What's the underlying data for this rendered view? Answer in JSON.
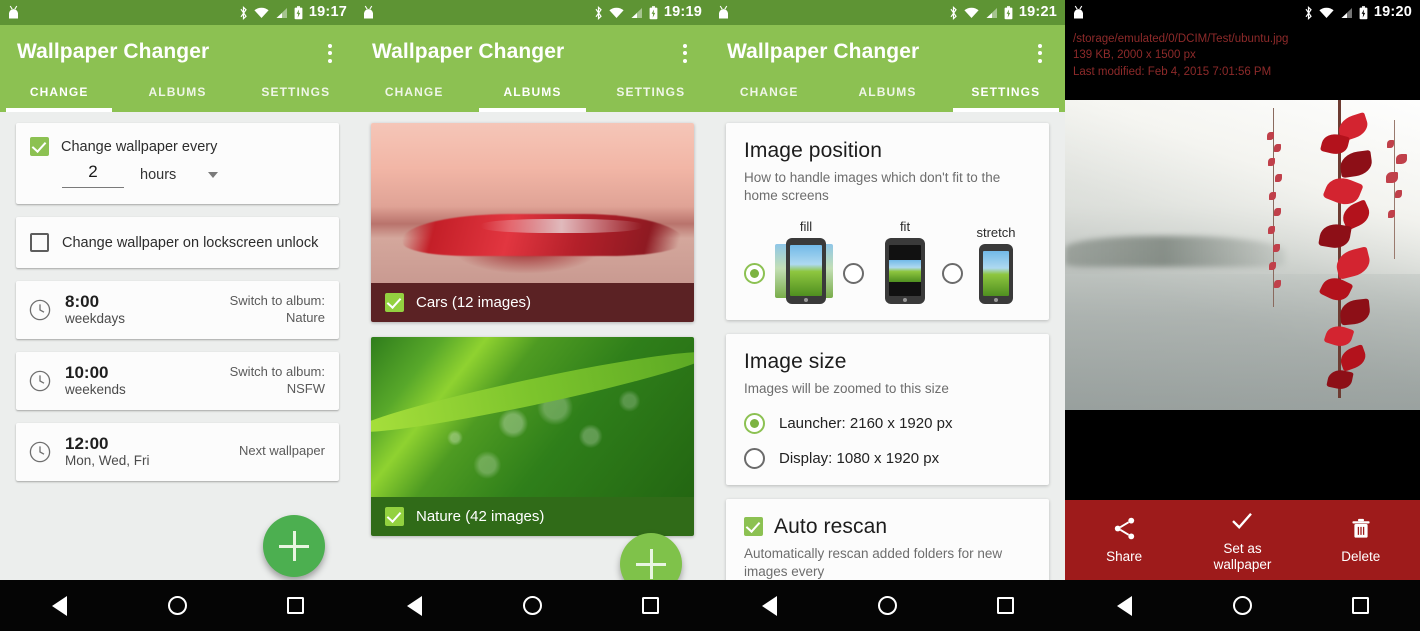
{
  "app": {
    "title": "Wallpaper Changer"
  },
  "panels": [
    {
      "status": {
        "time": "19:17"
      },
      "tabs": [
        {
          "label": "CHANGE",
          "active": true
        },
        {
          "label": "ALBUMS",
          "active": false
        },
        {
          "label": "SETTINGS",
          "active": false
        }
      ],
      "interval_card": {
        "label": "Change wallpaper every",
        "checked": true,
        "value": "2",
        "unit": "hours"
      },
      "lockscreen_card": {
        "label": "Change wallpaper on lockscreen unlock",
        "checked": false
      },
      "schedules": [
        {
          "time": "8:00",
          "days": "weekdays",
          "action_line1": "Switch to album:",
          "action_line2": "Nature"
        },
        {
          "time": "10:00",
          "days": "weekends",
          "action_line1": "Switch to album:",
          "action_line2": "NSFW"
        },
        {
          "time": "12:00",
          "days": "Mon, Wed, Fri",
          "action_line1": "Next wallpaper",
          "action_line2": ""
        }
      ],
      "fab": {
        "icon": "plus-icon"
      }
    },
    {
      "status": {
        "time": "19:19"
      },
      "tabs": [
        {
          "label": "CHANGE",
          "active": false
        },
        {
          "label": "ALBUMS",
          "active": true
        },
        {
          "label": "SETTINGS",
          "active": false
        }
      ],
      "albums": [
        {
          "name": "Cars (12 images)",
          "checked": true,
          "thumb": "red-sports-car-at-sunset"
        },
        {
          "name": "Nature (42 images)",
          "checked": true,
          "thumb": "green-leaf-with-water-drops"
        }
      ],
      "fab": {
        "icon": "plus-icon"
      }
    },
    {
      "status": {
        "time": "19:21"
      },
      "tabs": [
        {
          "label": "CHANGE",
          "active": false
        },
        {
          "label": "ALBUMS",
          "active": false
        },
        {
          "label": "SETTINGS",
          "active": true
        }
      ],
      "image_position": {
        "title": "Image position",
        "subtitle": "How to handle images which don't fit to the home screens",
        "options": [
          {
            "label": "fill",
            "selected": true
          },
          {
            "label": "fit",
            "selected": false
          },
          {
            "label": "stretch",
            "selected": false
          }
        ]
      },
      "image_size": {
        "title": "Image size",
        "subtitle": "Images will be zoomed to this size",
        "options": [
          {
            "label": "Launcher: 2160 x 1920 px",
            "selected": true
          },
          {
            "label": "Display: 1080 x 1920 px",
            "selected": false
          }
        ]
      },
      "auto_rescan": {
        "title": "Auto rescan",
        "checked": true,
        "subtitle": "Automatically rescan added folders for new images every"
      }
    },
    {
      "status": {
        "time": "19:20"
      },
      "file_info": {
        "path": "/storage/emulated/0/DCIM/Test/ubuntu.jpg",
        "size_dimensions": "139 KB, 2000 x 1500 px",
        "last_modified": "Last modified: Feb 4, 2015 7:01:56 PM",
        "text_color": "#8d2a2a"
      },
      "photo_alt": "misty-lake-with-red-vine-leaves",
      "actions": [
        {
          "label": "Share",
          "icon": "share-icon"
        },
        {
          "label": "Set as\nwallpaper",
          "label_line1": "Set as",
          "label_line2": "wallpaper",
          "icon": "check-icon"
        },
        {
          "label": "Delete",
          "icon": "trash-icon"
        }
      ],
      "action_bar_color": "#9e1b1b"
    }
  ],
  "navbar": {
    "back": "back-icon",
    "home": "home-icon",
    "recents": "recents-icon"
  },
  "colors": {
    "appbar_green": "#8cc152",
    "statusbar_green": "#5e9434",
    "fab_green": "#4caf50",
    "accent_red": "#9e1b1b"
  }
}
